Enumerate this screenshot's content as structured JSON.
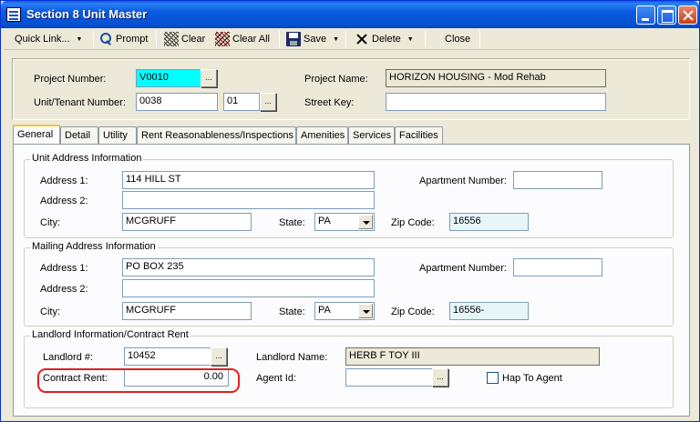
{
  "window": {
    "title": "Section 8 Unit Master"
  },
  "toolbar": {
    "quick_link": "Quick Link...",
    "prompt": "Prompt",
    "clear": "Clear",
    "clear_all": "Clear All",
    "save": "Save",
    "delete": "Delete",
    "close": "Close"
  },
  "header": {
    "project_number_label": "Project Number:",
    "project_number": "V0010",
    "project_name_label": "Project Name:",
    "project_name": "HORIZON HOUSING - Mod Rehab",
    "unit_label": "Unit/Tenant Number:",
    "unit_number": "0038",
    "tenant_number": "01",
    "street_key_label": "Street Key:",
    "street_key": ""
  },
  "tabs": [
    "General",
    "Detail",
    "Utility",
    "Rent Reasonableness/Inspections",
    "Amenities",
    "Services",
    "Facilities"
  ],
  "unit_address": {
    "title": "Unit Address Information",
    "address1_label": "Address 1:",
    "address1": "114 HILL ST",
    "address2_label": "Address 2:",
    "address2": "",
    "apt_label": "Apartment Number:",
    "apt": "",
    "city_label": "City:",
    "city": "MCGRUFF",
    "state_label": "State:",
    "state": "PA",
    "zip_label": "Zip Code:",
    "zip": "16556"
  },
  "mailing_address": {
    "title": "Mailing Address Information",
    "address1_label": "Address 1:",
    "address1": "PO BOX 235",
    "address2_label": "Address 2:",
    "address2": "",
    "apt_label": "Apartment Number:",
    "apt": "",
    "city_label": "City:",
    "city": "MCGRUFF",
    "state_label": "State:",
    "state": "PA",
    "zip_label": "Zip Code:",
    "zip": "16556-"
  },
  "landlord": {
    "title": "Landlord Information/Contract Rent",
    "landlord_label": "Landlord #:",
    "landlord_number": "10452",
    "landlord_name_label": "Landlord Name:",
    "landlord_name": "HERB F TOY III",
    "contract_rent_label": "Contract Rent:",
    "contract_rent": "0.00",
    "agent_id_label": "Agent Id:",
    "agent_id": "",
    "hap_label": "Hap To Agent"
  },
  "colors": {
    "highlight": "#e0201c",
    "title_bar": "#0a5ae0"
  }
}
